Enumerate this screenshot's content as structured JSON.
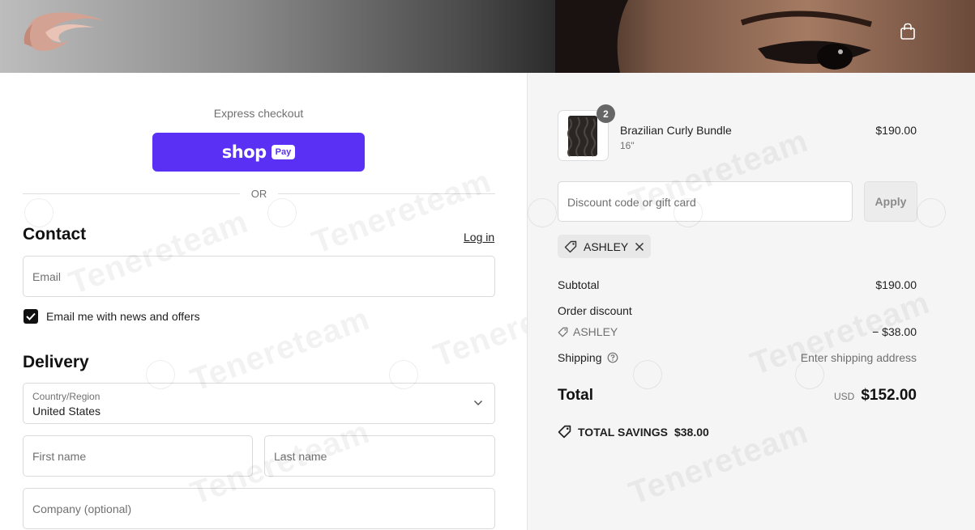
{
  "header": {
    "logo_icon": "hair-wave-logo",
    "cart_icon": "shopping-bag-icon"
  },
  "express": {
    "label": "Express checkout",
    "shop_word": "shop",
    "pay_badge": "Pay",
    "or": "OR"
  },
  "contact": {
    "title": "Contact",
    "login": "Log in",
    "email_placeholder": "Email",
    "newsletter_label": "Email me with news and offers",
    "newsletter_checked": true
  },
  "delivery": {
    "title": "Delivery",
    "country_label": "Country/Region",
    "country_value": "United States",
    "first_name_placeholder": "First name",
    "last_name_placeholder": "Last name",
    "company_placeholder": "Company (optional)"
  },
  "summary": {
    "product": {
      "name": "Brazilian Curly Bundle",
      "variant": "16\"",
      "price": "$190.00",
      "quantity": "2"
    },
    "discount_placeholder": "Discount code or gift card",
    "apply_label": "Apply",
    "applied_code": "ASHLEY",
    "subtotal_label": "Subtotal",
    "subtotal_value": "$190.00",
    "order_discount_label": "Order discount",
    "order_discount_code": "ASHLEY",
    "order_discount_value": "− $38.00",
    "shipping_label": "Shipping",
    "shipping_value": "Enter shipping address",
    "total_label": "Total",
    "total_currency": "USD",
    "total_value": "$152.00",
    "savings_label": "TOTAL SAVINGS",
    "savings_value": "$38.00"
  },
  "watermark": {
    "text": "Tenereteam"
  },
  "colors": {
    "shop_pay": "#5a31f4",
    "summary_bg": "#f5f5f5",
    "muted": "#707070"
  }
}
